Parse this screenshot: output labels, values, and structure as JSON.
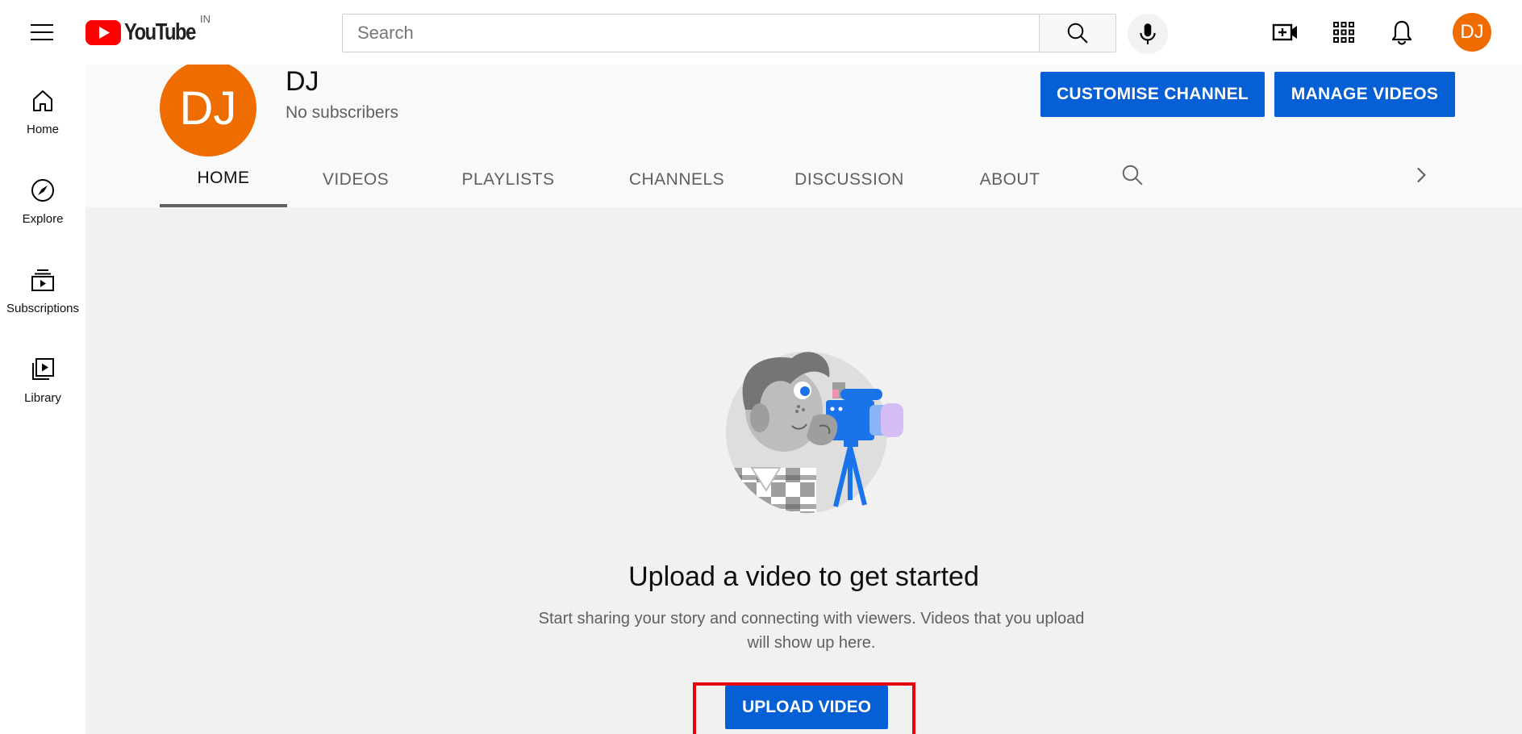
{
  "header": {
    "logo_text": "YouTube",
    "region": "IN",
    "search_placeholder": "Search",
    "user_initials": "DJ"
  },
  "sidebar": {
    "items": [
      {
        "label": "Home",
        "icon": "home-icon"
      },
      {
        "label": "Explore",
        "icon": "compass-icon"
      },
      {
        "label": "Subscriptions",
        "icon": "subscriptions-icon"
      },
      {
        "label": "Library",
        "icon": "library-icon"
      }
    ]
  },
  "channel": {
    "initials": "DJ",
    "name": "DJ",
    "subscribers": "No subscribers",
    "customise_label": "CUSTOMISE CHANNEL",
    "manage_label": "MANAGE VIDEOS"
  },
  "tabs": [
    {
      "label": "HOME",
      "active": true
    },
    {
      "label": "VIDEOS"
    },
    {
      "label": "PLAYLISTS"
    },
    {
      "label": "CHANNELS"
    },
    {
      "label": "DISCUSSION"
    },
    {
      "label": "ABOUT"
    }
  ],
  "empty_state": {
    "title": "Upload a video to get started",
    "description": "Start sharing your story and connecting with viewers. Videos that you upload will show up here.",
    "button_label": "UPLOAD VIDEO"
  },
  "colors": {
    "brand_red": "#ff0000",
    "accent_blue": "#065fd4",
    "avatar_orange": "#ef6c00",
    "highlight_red": "#e8000b"
  }
}
